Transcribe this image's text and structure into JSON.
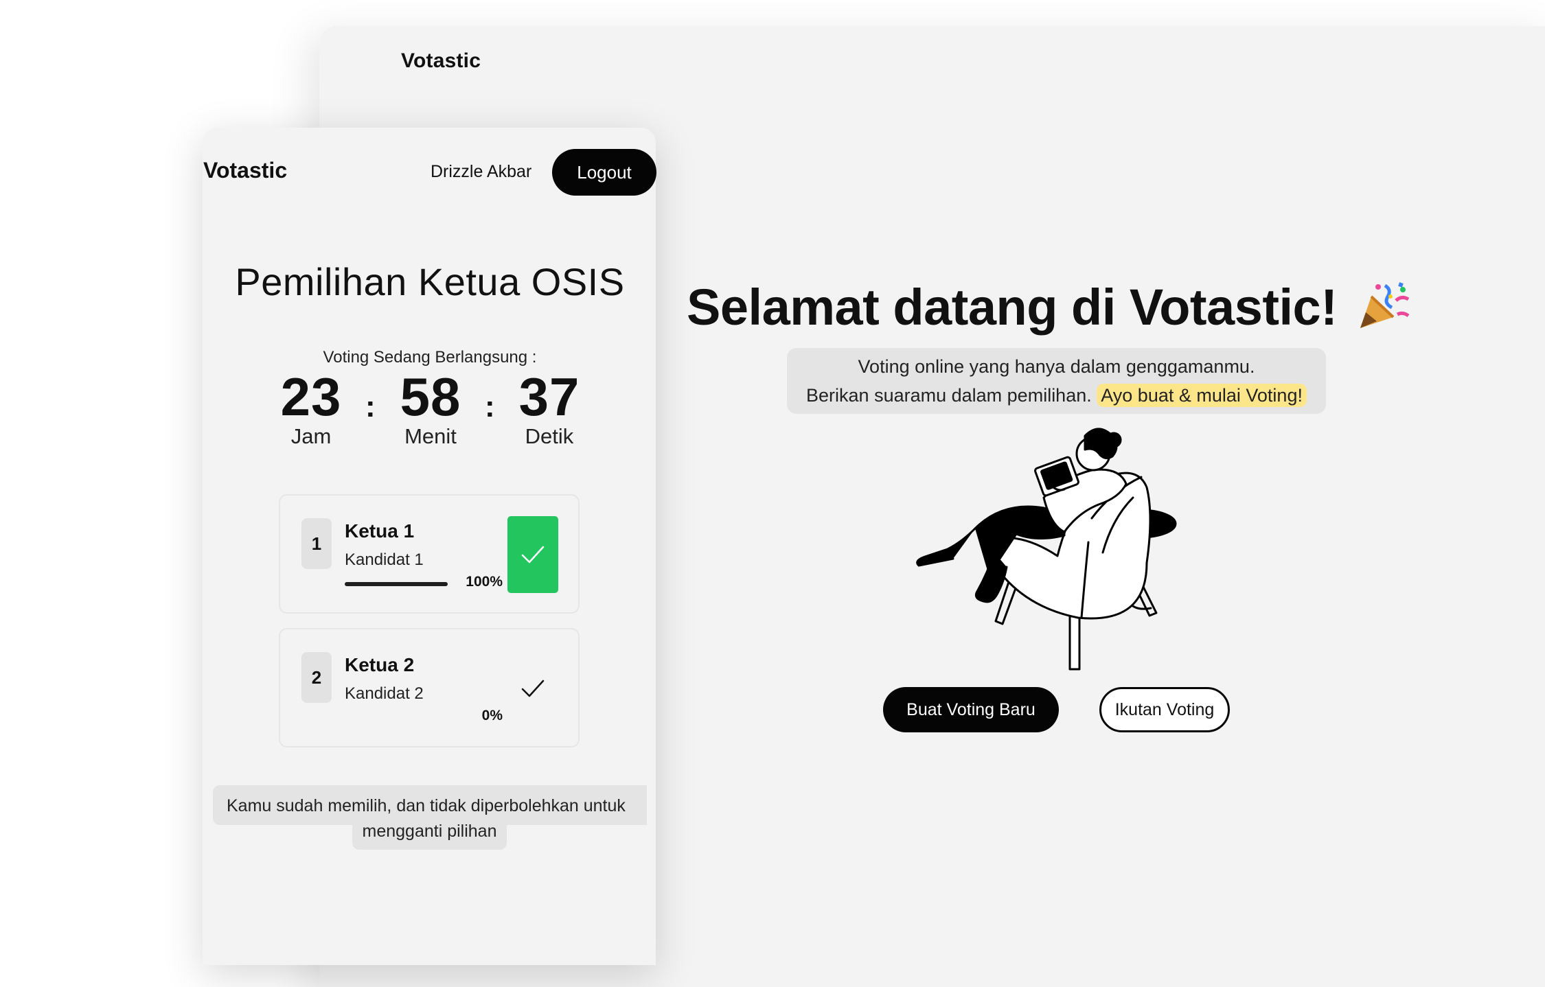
{
  "desktop": {
    "brand": "Votastic",
    "hero": {
      "title": "Selamat datang di Votastic!",
      "line1": "Voting online yang hanya dalam genggamanmu.",
      "line2": "Berikan suaramu dalam pemilihan.",
      "highlight": "Ayo buat & mulai Voting!",
      "emoji_icon": "party-popper-icon"
    },
    "buttons": {
      "create": "Buat Voting Baru",
      "join": "Ikutan Voting"
    }
  },
  "mobile": {
    "brand": "Votastic",
    "user_name": "Drizzle Akbar",
    "logout_label": "Logout",
    "title": "Pemilihan Ketua OSIS",
    "status": "Voting Sedang Berlangsung :",
    "timer": {
      "hours": "23",
      "minutes": "58",
      "seconds": "37",
      "hours_label": "Jam",
      "minutes_label": "Menit",
      "seconds_label": "Detik",
      "separator": ":"
    },
    "candidates": [
      {
        "number": "1",
        "name": "Ketua 1",
        "subtitle": "Kandidat 1",
        "percent": "100%",
        "share": 1.0,
        "selected": true
      },
      {
        "number": "2",
        "name": "Ketua 2",
        "subtitle": "Kandidat 2",
        "percent": "0%",
        "share": 0.0,
        "selected": false
      }
    ],
    "notice_line1": "Kamu sudah memilih, dan tidak diperbolehkan untuk",
    "notice_line2": "mengganti pilihan"
  },
  "colors": {
    "accent": "#050505",
    "selected": "#22c55e",
    "highlight": "#fde68a",
    "panel": "#f3f3f3"
  }
}
